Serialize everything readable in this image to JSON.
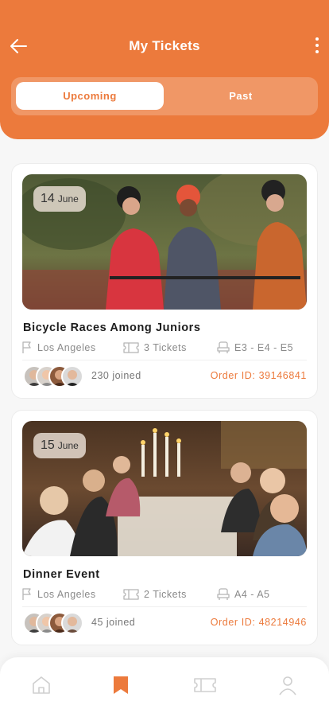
{
  "header": {
    "title": "My Tickets",
    "back_icon": "arrow-left-icon",
    "more_icon": "more-vertical-icon"
  },
  "segments": {
    "upcoming": "Upcoming",
    "past": "Past",
    "selected": "Upcoming"
  },
  "events": [
    {
      "date_day": "14",
      "date_month": "June",
      "title": "Bicycle Races Among Juniors",
      "location": "Los Angeles",
      "tickets": "3 Tickets",
      "seats": "E3 - E4 - E5",
      "joined": "230 joined",
      "order_id": "Order ID: 39146841"
    },
    {
      "date_day": "15",
      "date_month": "June",
      "title": "Dinner Event",
      "location": "Los Angeles",
      "tickets": "2 Tickets",
      "seats": "A4 - A5",
      "joined": "45 joined",
      "order_id": "Order ID: 48214946"
    }
  ],
  "tabbar": {
    "items": [
      "home-icon",
      "bookmark-icon",
      "ticket-icon",
      "profile-icon"
    ],
    "active": "bookmark-icon"
  },
  "colors": {
    "accent": "#EC7A3C",
    "background": "#F7F7F7",
    "muted": "#8A8A8A"
  }
}
